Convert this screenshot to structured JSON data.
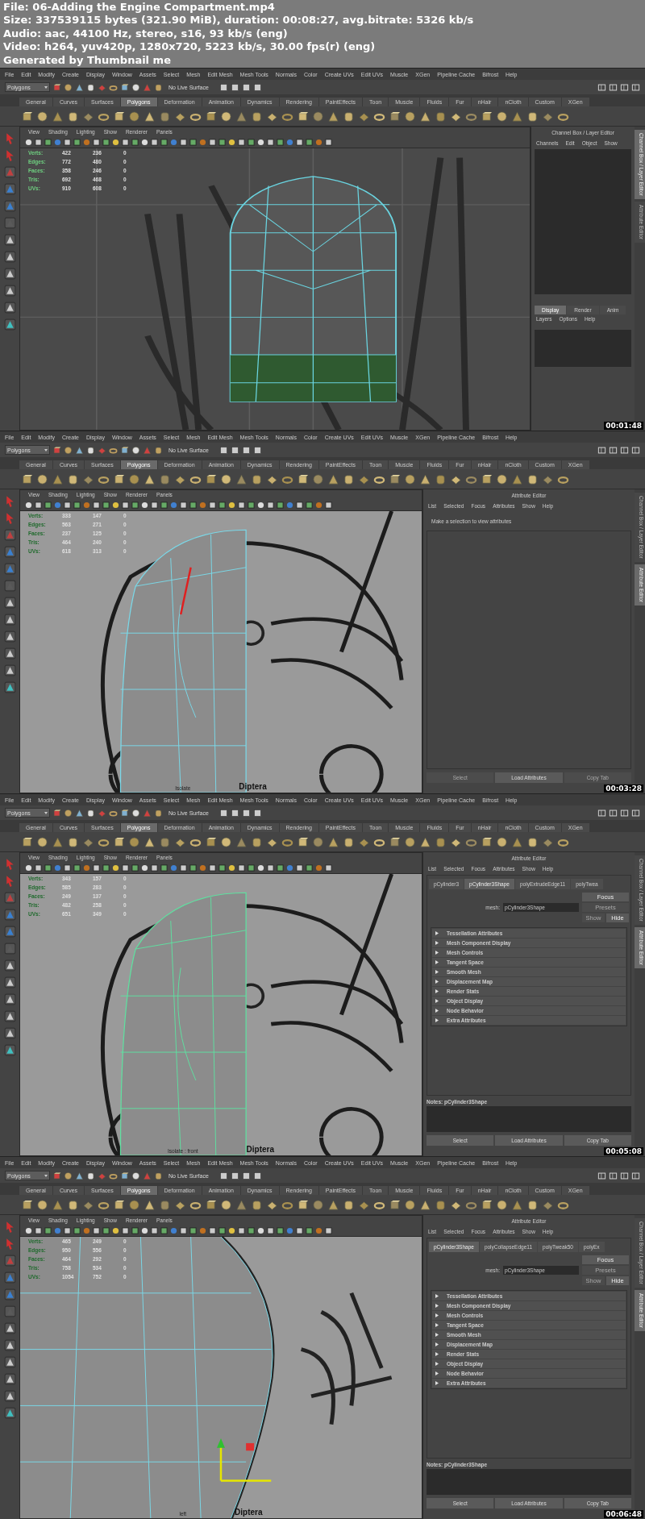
{
  "header": [
    "File: 06-Adding the Engine Compartment.mp4",
    "Size: 337539115 bytes (321.90 MiB), duration: 00:08:27, avg.bitrate: 5326 kb/s",
    "Audio: aac, 44100 Hz, stereo, s16, 93 kb/s (eng)",
    "Video: h264, yuv420p, 1280x720, 5223 kb/s, 30.00 fps(r) (eng)",
    "Generated by Thumbnail me"
  ],
  "frames": [
    {
      "menu_bar": [
        "File",
        "Edit",
        "Modify",
        "Create",
        "Display",
        "Window",
        "Assets",
        "Select",
        "Mesh",
        "Edit Mesh",
        "Mesh Tools",
        "Normals",
        "Color",
        "Create UVs",
        "Edit UVs",
        "Muscle",
        "XGen",
        "Pipeline Cache",
        "Bifrost",
        "Help"
      ],
      "toolbar": {
        "mode": "Polygons",
        "live_surface": "No Live Surface"
      },
      "shelf_tabs": [
        {
          "label": "General",
          "selected": false
        },
        {
          "label": "Curves",
          "selected": false
        },
        {
          "label": "Surfaces",
          "selected": false
        },
        {
          "label": "Polygons",
          "selected": true
        },
        {
          "label": "Deformation",
          "selected": false
        },
        {
          "label": "Animation",
          "selected": false
        },
        {
          "label": "Dynamics",
          "selected": false
        },
        {
          "label": "Rendering",
          "selected": false
        },
        {
          "label": "PaintEffects",
          "selected": false
        },
        {
          "label": "Toon",
          "selected": false
        },
        {
          "label": "Muscle",
          "selected": false
        },
        {
          "label": "Fluids",
          "selected": false
        },
        {
          "label": "Fur",
          "selected": false
        },
        {
          "label": "nHair",
          "selected": false
        },
        {
          "label": "nCloth",
          "selected": false
        },
        {
          "label": "Custom",
          "selected": false
        },
        {
          "label": "XGen",
          "selected": false
        }
      ],
      "panel_menu": [
        "View",
        "Shading",
        "Lighting",
        "Show",
        "Renderer",
        "Panels"
      ],
      "stats": [
        {
          "label": "Verts:",
          "values": [
            "422",
            "236",
            "0"
          ]
        },
        {
          "label": "Edges:",
          "values": [
            "772",
            "480",
            "0"
          ]
        },
        {
          "label": "Faces:",
          "values": [
            "358",
            "246",
            "0"
          ]
        },
        {
          "label": "Tris:",
          "values": [
            "692",
            "468",
            "0"
          ]
        },
        {
          "label": "UVs:",
          "values": [
            "910",
            "608",
            "0"
          ]
        }
      ],
      "viewport": {
        "kind": "dome"
      },
      "side_panel": {
        "kind": "channel_box",
        "title": "Channel Box / Layer Editor",
        "menus": [
          "Channels",
          "Edit",
          "Object",
          "Show"
        ],
        "layer_tabs": [
          {
            "label": "Display",
            "selected": true
          },
          {
            "label": "Render",
            "selected": false
          },
          {
            "label": "Anim",
            "selected": false
          }
        ],
        "layer_menus": [
          "Layers",
          "Options",
          "Help"
        ]
      },
      "side_tabs": [
        {
          "label": "Channel Box / Layer Editor",
          "selected": true
        },
        {
          "label": "Attribute Editor",
          "selected": false
        }
      ],
      "timestamp": "00:01:48"
    },
    {
      "menu_bar": [
        "File",
        "Edit",
        "Modify",
        "Create",
        "Display",
        "Window",
        "Assets",
        "Select",
        "Mesh",
        "Edit Mesh",
        "Mesh Tools",
        "Normals",
        "Color",
        "Create UVs",
        "Edit UVs",
        "Muscle",
        "XGen",
        "Pipeline Cache",
        "Bifrost",
        "Help"
      ],
      "toolbar": {
        "mode": "Polygons",
        "live_surface": "No Live Surface"
      },
      "shelf_tabs": [
        {
          "label": "General",
          "selected": false
        },
        {
          "label": "Curves",
          "selected": false
        },
        {
          "label": "Surfaces",
          "selected": false
        },
        {
          "label": "Polygons",
          "selected": true
        },
        {
          "label": "Deformation",
          "selected": false
        },
        {
          "label": "Animation",
          "selected": false
        },
        {
          "label": "Dynamics",
          "selected": false
        },
        {
          "label": "Rendering",
          "selected": false
        },
        {
          "label": "PaintEffects",
          "selected": false
        },
        {
          "label": "Toon",
          "selected": false
        },
        {
          "label": "Muscle",
          "selected": false
        },
        {
          "label": "Fluids",
          "selected": false
        },
        {
          "label": "Fur",
          "selected": false
        },
        {
          "label": "nHair",
          "selected": false
        },
        {
          "label": "nCloth",
          "selected": false
        },
        {
          "label": "Custom",
          "selected": false
        },
        {
          "label": "XGen",
          "selected": false
        }
      ],
      "panel_menu": [
        "View",
        "Shading",
        "Lighting",
        "Show",
        "Renderer",
        "Panels"
      ],
      "stats": [
        {
          "label": "Verts:",
          "values": [
            "333",
            "147",
            "0"
          ]
        },
        {
          "label": "Edges:",
          "values": [
            "563",
            "271",
            "0"
          ]
        },
        {
          "label": "Faces:",
          "values": [
            "237",
            "125",
            "0"
          ]
        },
        {
          "label": "Tris:",
          "values": [
            "464",
            "240",
            "0"
          ]
        },
        {
          "label": "UVs:",
          "values": [
            "618",
            "313",
            "0"
          ]
        }
      ],
      "viewport": {
        "kind": "front",
        "labels": [
          "Isolate",
          "Diptera"
        ]
      },
      "side_panel": {
        "kind": "attribute_editor",
        "title": "Attribute Editor",
        "menus": [
          "List",
          "Selected",
          "Focus",
          "Attributes",
          "Show",
          "Help"
        ],
        "message": "Make a selection to view attributes",
        "buttons": [
          {
            "label": "Select",
            "disabled": true
          },
          {
            "label": "Load Attributes",
            "disabled": false
          },
          {
            "label": "Copy Tab",
            "disabled": true
          }
        ]
      },
      "side_tabs": [
        {
          "label": "Channel Box / Layer Editor",
          "selected": false
        },
        {
          "label": "Attribute Editor",
          "selected": true
        }
      ],
      "timestamp": "00:03:28"
    },
    {
      "menu_bar": [
        "File",
        "Edit",
        "Modify",
        "Create",
        "Display",
        "Window",
        "Assets",
        "Select",
        "Mesh",
        "Edit Mesh",
        "Mesh Tools",
        "Normals",
        "Color",
        "Create UVs",
        "Edit UVs",
        "Muscle",
        "XGen",
        "Pipeline Cache",
        "Bifrost",
        "Help"
      ],
      "toolbar": {
        "mode": "Polygons",
        "live_surface": "No Live Surface"
      },
      "shelf_tabs": [
        {
          "label": "General",
          "selected": false
        },
        {
          "label": "Curves",
          "selected": false
        },
        {
          "label": "Surfaces",
          "selected": false
        },
        {
          "label": "Polygons",
          "selected": true
        },
        {
          "label": "Deformation",
          "selected": false
        },
        {
          "label": "Animation",
          "selected": false
        },
        {
          "label": "Dynamics",
          "selected": false
        },
        {
          "label": "Rendering",
          "selected": false
        },
        {
          "label": "PaintEffects",
          "selected": false
        },
        {
          "label": "Toon",
          "selected": false
        },
        {
          "label": "Muscle",
          "selected": false
        },
        {
          "label": "Fluids",
          "selected": false
        },
        {
          "label": "Fur",
          "selected": false
        },
        {
          "label": "nHair",
          "selected": false
        },
        {
          "label": "nCloth",
          "selected": false
        },
        {
          "label": "Custom",
          "selected": false
        },
        {
          "label": "XGen",
          "selected": false
        }
      ],
      "panel_menu": [
        "View",
        "Shading",
        "Lighting",
        "Show",
        "Renderer",
        "Panels"
      ],
      "stats": [
        {
          "label": "Verts:",
          "values": [
            "343",
            "157",
            "0"
          ]
        },
        {
          "label": "Edges:",
          "values": [
            "585",
            "283",
            "0"
          ]
        },
        {
          "label": "Faces:",
          "values": [
            "249",
            "137",
            "0"
          ]
        },
        {
          "label": "Tris:",
          "values": [
            "482",
            "258",
            "0"
          ]
        },
        {
          "label": "UVs:",
          "values": [
            "651",
            "349",
            "0"
          ]
        }
      ],
      "viewport": {
        "kind": "front_green",
        "labels": [
          "Isolate : front",
          "Diptera"
        ]
      },
      "side_panel": {
        "kind": "attribute_editor",
        "title": "Attribute Editor",
        "menus": [
          "List",
          "Selected",
          "Focus",
          "Attributes",
          "Show",
          "Help"
        ],
        "node_tabs": [
          {
            "label": "pCylinder3",
            "selected": false
          },
          {
            "label": "pCylinder3Shape",
            "selected": true
          },
          {
            "label": "polyExtrudeEdge11",
            "selected": false
          },
          {
            "label": "polyTwea",
            "selected": false
          }
        ],
        "node_field": {
          "label": "mesh:",
          "value": "pCylinder3Shape"
        },
        "side_buttons": [
          {
            "label": "Focus",
            "disabled": false
          },
          {
            "label": "Presets",
            "disabled": true
          },
          {
            "label": "Show",
            "disabled": true
          },
          {
            "label": "Hide",
            "disabled": false
          }
        ],
        "sections": [
          "Tessellation Attributes",
          "Mesh Component Display",
          "Mesh Controls",
          "Tangent Space",
          "Smooth Mesh",
          "Displacement Map",
          "Render Stats",
          "Object Display",
          "Node Behavior",
          "Extra Attributes"
        ],
        "notes_label": "Notes: pCylinder3Shape",
        "buttons": [
          {
            "label": "Select",
            "disabled": false
          },
          {
            "label": "Load Attributes",
            "disabled": false
          },
          {
            "label": "Copy Tab",
            "disabled": false
          }
        ]
      },
      "side_tabs": [
        {
          "label": "Channel Box / Layer Editor",
          "selected": false
        },
        {
          "label": "Attribute Editor",
          "selected": true
        }
      ],
      "timestamp": "00:05:08"
    },
    {
      "menu_bar": [
        "File",
        "Edit",
        "Modify",
        "Create",
        "Display",
        "Window",
        "Assets",
        "Select",
        "Mesh",
        "Edit Mesh",
        "Mesh Tools",
        "Normals",
        "Color",
        "Create UVs",
        "Edit UVs",
        "Muscle",
        "XGen",
        "Pipeline Cache",
        "Bifrost",
        "Help"
      ],
      "toolbar": {
        "mode": "Polygons",
        "live_surface": "No Live Surface"
      },
      "shelf_tabs": [
        {
          "label": "General",
          "selected": false
        },
        {
          "label": "Curves",
          "selected": false
        },
        {
          "label": "Surfaces",
          "selected": false
        },
        {
          "label": "Polygons",
          "selected": true
        },
        {
          "label": "Deformation",
          "selected": false
        },
        {
          "label": "Animation",
          "selected": false
        },
        {
          "label": "Dynamics",
          "selected": false
        },
        {
          "label": "Rendering",
          "selected": false
        },
        {
          "label": "PaintEffects",
          "selected": false
        },
        {
          "label": "Toon",
          "selected": false
        },
        {
          "label": "Muscle",
          "selected": false
        },
        {
          "label": "Fluids",
          "selected": false
        },
        {
          "label": "Fur",
          "selected": false
        },
        {
          "label": "nHair",
          "selected": false
        },
        {
          "label": "nCloth",
          "selected": false
        },
        {
          "label": "Custom",
          "selected": false
        },
        {
          "label": "XGen",
          "selected": false
        }
      ],
      "panel_menu": [
        "View",
        "Shading",
        "Lighting",
        "Show",
        "Renderer",
        "Panels"
      ],
      "stats": [
        {
          "label": "Verts:",
          "values": [
            "465",
            "249",
            "0"
          ]
        },
        {
          "label": "Edges:",
          "values": [
            "950",
            "556",
            "0"
          ]
        },
        {
          "label": "Faces:",
          "values": [
            "464",
            "292",
            "0"
          ]
        },
        {
          "label": "Tris:",
          "values": [
            "758",
            "534",
            "0"
          ]
        },
        {
          "label": "UVs:",
          "values": [
            "1054",
            "752",
            "0"
          ]
        }
      ],
      "viewport": {
        "kind": "closeup",
        "labels": [
          "left",
          "Diptera"
        ]
      },
      "side_panel": {
        "kind": "attribute_editor",
        "title": "Attribute Editor",
        "menus": [
          "List",
          "Selected",
          "Focus",
          "Attributes",
          "Show",
          "Help"
        ],
        "node_tabs": [
          {
            "label": "pCylinder3Shape",
            "selected": true
          },
          {
            "label": "polyCollapseEdge11",
            "selected": false
          },
          {
            "label": "polyTweak50",
            "selected": false
          },
          {
            "label": "polyEx",
            "selected": false
          }
        ],
        "node_field": {
          "label": "mesh:",
          "value": "pCylinder3Shape"
        },
        "side_buttons": [
          {
            "label": "Focus",
            "disabled": false
          },
          {
            "label": "Presets",
            "disabled": true
          },
          {
            "label": "Show",
            "disabled": true
          },
          {
            "label": "Hide",
            "disabled": false
          }
        ],
        "sections": [
          "Tessellation Attributes",
          "Mesh Component Display",
          "Mesh Controls",
          "Tangent Space",
          "Smooth Mesh",
          "Displacement Map",
          "Render Stats",
          "Object Display",
          "Node Behavior",
          "Extra Attributes"
        ],
        "notes_label": "Notes: pCylinder3Shape",
        "buttons": [
          {
            "label": "Select",
            "disabled": false
          },
          {
            "label": "Load Attributes",
            "disabled": false
          },
          {
            "label": "Copy Tab",
            "disabled": false
          }
        ]
      },
      "side_tabs": [
        {
          "label": "Channel Box / Layer Editor",
          "selected": false
        },
        {
          "label": "Attribute Editor",
          "selected": true
        }
      ],
      "timestamp": "00:06:48"
    }
  ]
}
